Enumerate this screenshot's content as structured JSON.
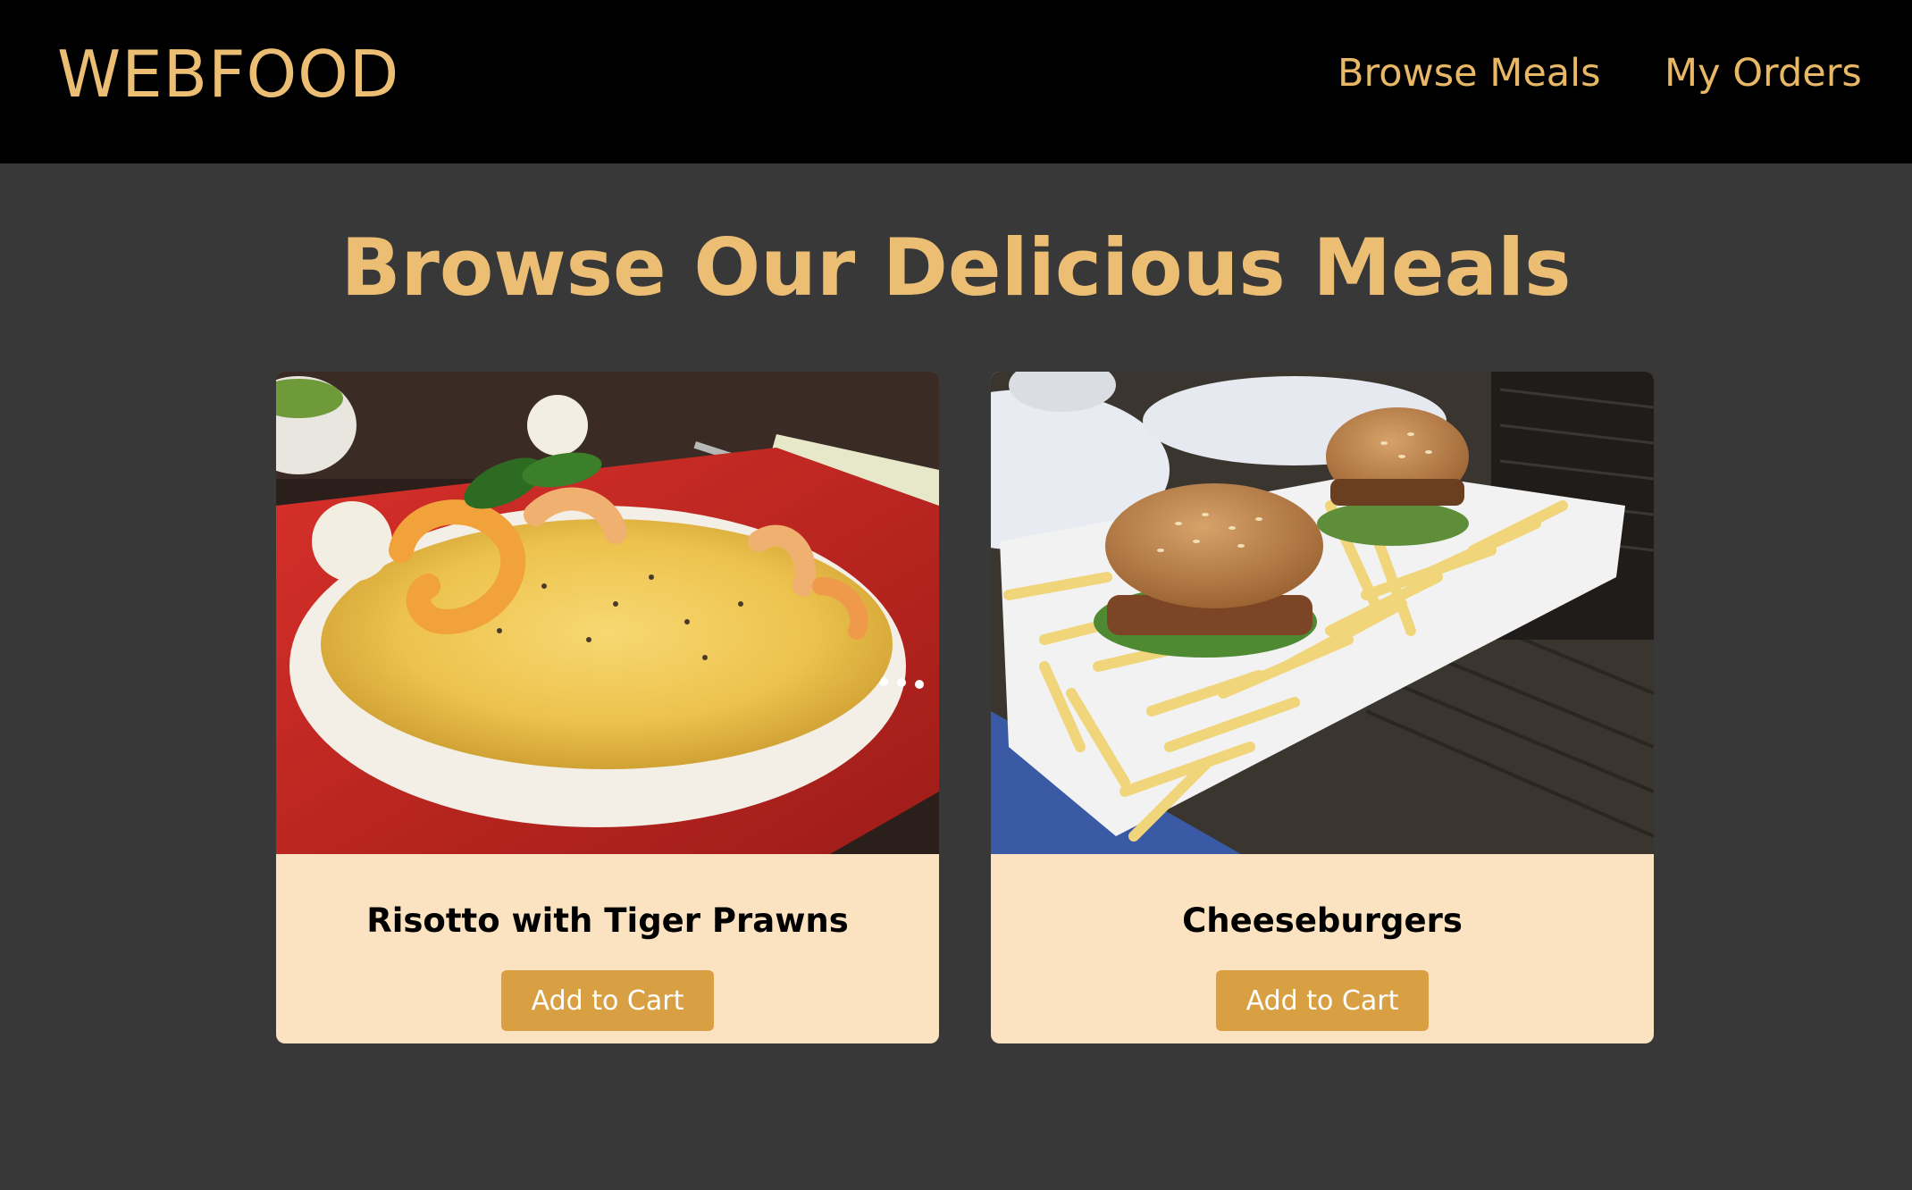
{
  "header": {
    "brand": "WEBFOOD",
    "nav": [
      {
        "label": "Browse Meals"
      },
      {
        "label": "My Orders"
      }
    ]
  },
  "main": {
    "title": "Browse Our Delicious Meals",
    "meals": [
      {
        "name": "Risotto with Tiger Prawns",
        "button_label": "Add to Cart",
        "image": "risotto-photo"
      },
      {
        "name": "Cheeseburgers",
        "button_label": "Add to Cart",
        "image": "cheeseburger-photo"
      }
    ]
  },
  "colors": {
    "header_bg": "#000000",
    "page_bg": "#383838",
    "accent": "#EBBE73",
    "card_bg": "#FBE3C1",
    "button_bg": "#D9A043",
    "button_text": "#FFFFFF"
  }
}
